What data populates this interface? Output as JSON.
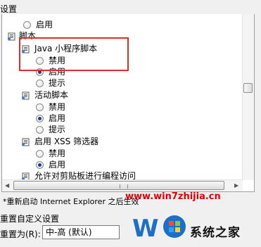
{
  "group_title": "设置",
  "tree": {
    "prev_enable": "启用",
    "script_category": "脚本",
    "java_applet": "Java 小程序脚本",
    "java_disable": "禁用",
    "java_enable": "启用",
    "java_prompt": "提示",
    "active_script": "活动脚本",
    "active_disable": "禁用",
    "active_enable": "启用",
    "active_prompt": "提示",
    "xss_filter": "启用 XSS 筛选器",
    "xss_disable": "禁用",
    "xss_enable": "启用",
    "clipboard": "允许对剪贴板进行编程访问"
  },
  "note": "*重新启动 Internet Explorer 之后生效",
  "reset_title": "重置自定义设置",
  "reset_label": "重置为(R):",
  "reset_value": "中-高 (默认)",
  "watermark": {
    "url": "www.win7zhijia.cn",
    "brand": "系统之家"
  },
  "colors": {
    "highlight": "#e22b2b",
    "watermark_url": "#e00000",
    "logo_blue": "#1b6fc9"
  },
  "icons": [
    "settings-icon",
    "radio-icon"
  ]
}
